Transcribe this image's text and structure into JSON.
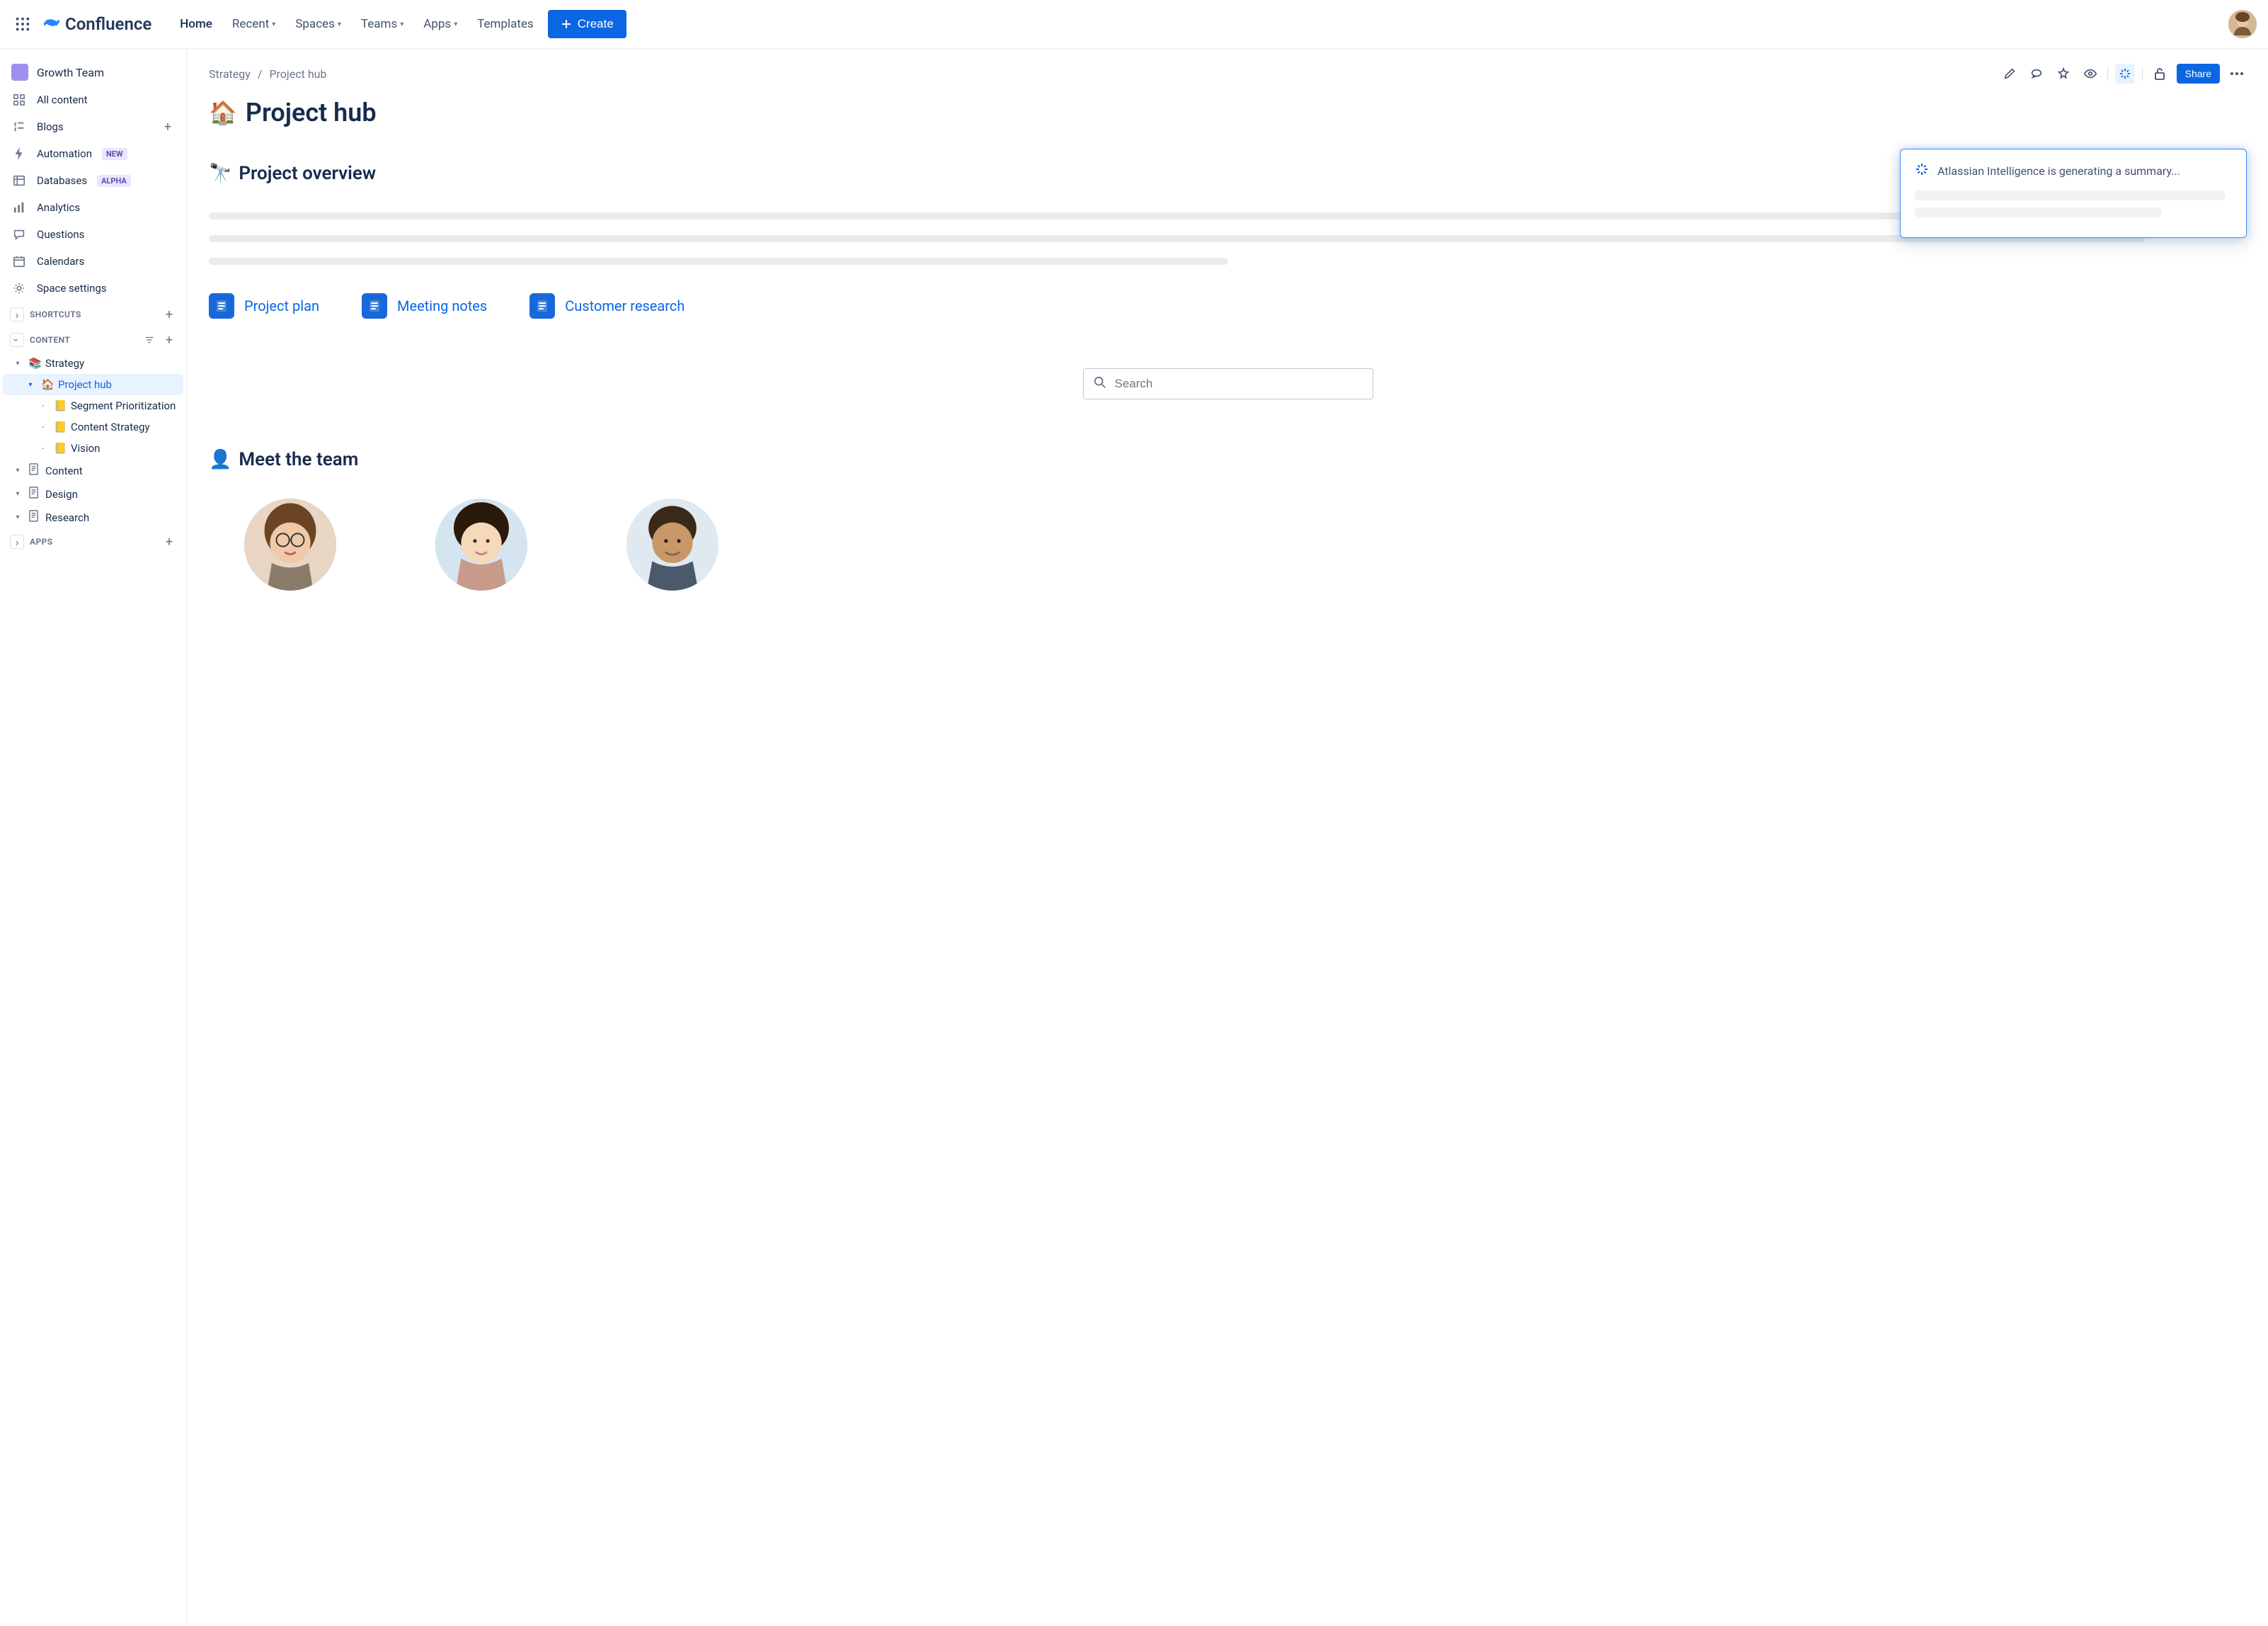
{
  "brand": {
    "name": "Confluence"
  },
  "nav": {
    "home": "Home",
    "recent": "Recent",
    "spaces": "Spaces",
    "teams": "Teams",
    "apps": "Apps",
    "templates": "Templates",
    "create": "Create"
  },
  "sidebar": {
    "space_name": "Growth Team",
    "items": {
      "all_content": "All content",
      "blogs": "Blogs",
      "automation": "Automation",
      "automation_badge": "NEW",
      "databases": "Databases",
      "databases_badge": "ALPHA",
      "analytics": "Analytics",
      "questions": "Questions",
      "calendars": "Calendars",
      "space_settings": "Space settings"
    },
    "sections": {
      "shortcuts": "SHORTCUTS",
      "content": "CONTENT",
      "apps": "APPS"
    },
    "tree": {
      "strategy": "Strategy",
      "project_hub": "Project hub",
      "segment_prioritization": "Segment Prioritization",
      "content_strategy": "Content Strategy",
      "vision": "Vision",
      "content": "Content",
      "design": "Design",
      "research": "Research"
    }
  },
  "breadcrumb": {
    "parent": "Strategy",
    "current": "Project hub"
  },
  "actions": {
    "share": "Share"
  },
  "page": {
    "title": "Project hub",
    "overview_heading": "Project overview",
    "meet_team_heading": "Meet the team",
    "doclinks": {
      "project_plan": "Project plan",
      "meeting_notes": "Meeting notes",
      "customer_research": "Customer research"
    },
    "search_placeholder": "Search"
  },
  "ai": {
    "message": "Atlassian Intelligence is generating a summary..."
  }
}
